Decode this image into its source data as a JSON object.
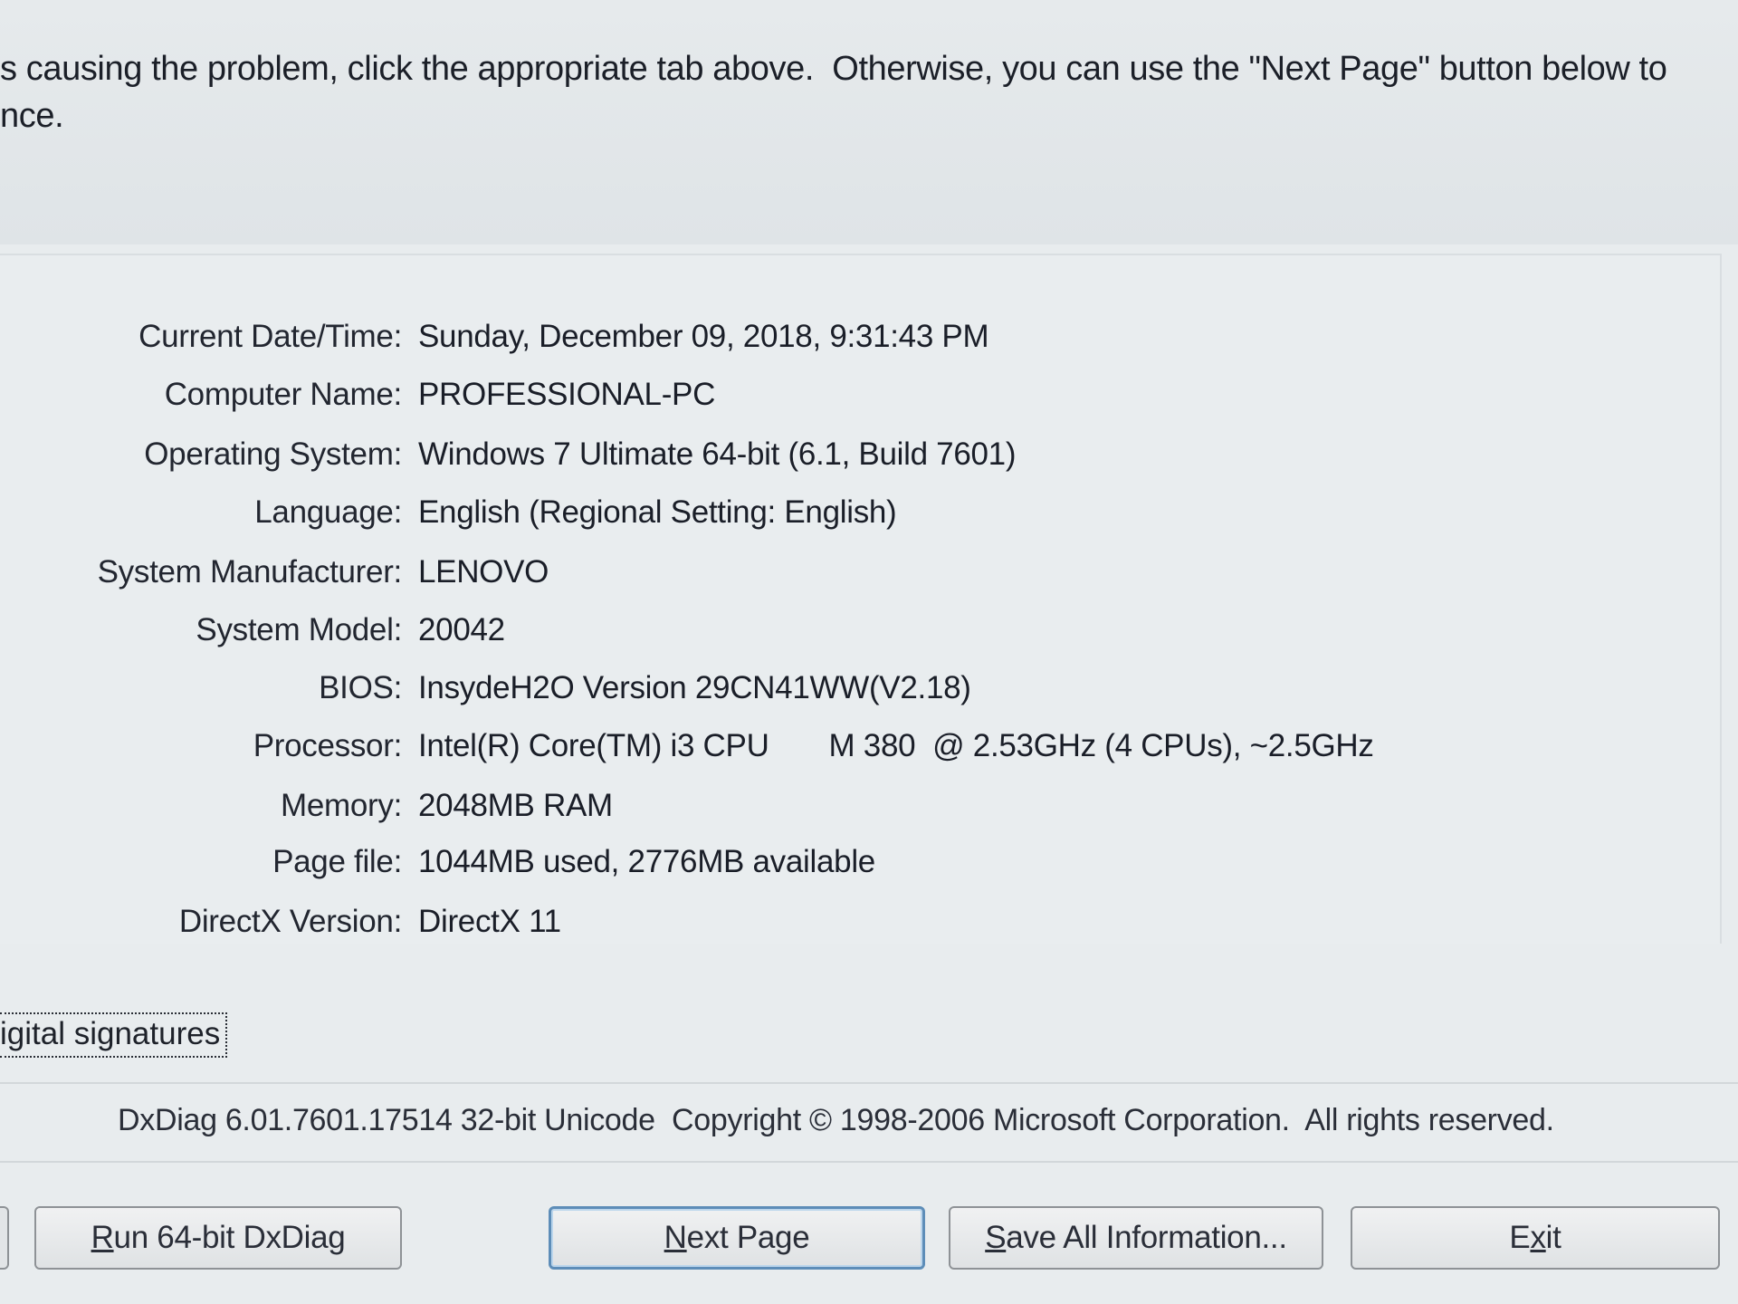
{
  "intro": {
    "line1": "s causing the problem, click the appropriate tab above.  Otherwise, you can use the \"Next Page\" button below to",
    "line2": "nce."
  },
  "system_info": [
    {
      "label": "Current Date/Time:",
      "value": "Sunday, December 09, 2018, 9:31:43 PM"
    },
    {
      "label": "Computer Name:",
      "value": "PROFESSIONAL-PC"
    },
    {
      "label": "Operating System:",
      "value": "Windows 7 Ultimate 64-bit (6.1, Build 7601)"
    },
    {
      "label": "Language:",
      "value": "English (Regional Setting: English)"
    },
    {
      "label": "System Manufacturer:",
      "value": "LENOVO"
    },
    {
      "label": "System Model:",
      "value": "20042"
    },
    {
      "label": "BIOS:",
      "value": "InsydeH2O Version 29CN41WW(V2.18)"
    },
    {
      "label": "Processor:",
      "value": "Intel(R) Core(TM) i3 CPU       M 380  @ 2.53GHz (4 CPUs), ~2.5GHz"
    },
    {
      "label": "Memory:",
      "value": "2048MB RAM"
    },
    {
      "label": "Page file:",
      "value": "1044MB used, 2776MB available"
    },
    {
      "label": "DirectX Version:",
      "value": "DirectX 11"
    }
  ],
  "signatures_check": "igital signatures",
  "copyright": "DxDiag 6.01.7601.17514 32-bit Unicode  Copyright © 1998-2006 Microsoft Corporation.  All rights reserved.",
  "buttons": {
    "run64": {
      "accel": "R",
      "rest": "un 64-bit DxDiag"
    },
    "next": {
      "accel": "N",
      "rest": "ext Page"
    },
    "save": {
      "accel": "S",
      "rest": "ave All Information..."
    },
    "exit": {
      "pre": "E",
      "accel": "x",
      "rest": "it"
    }
  }
}
